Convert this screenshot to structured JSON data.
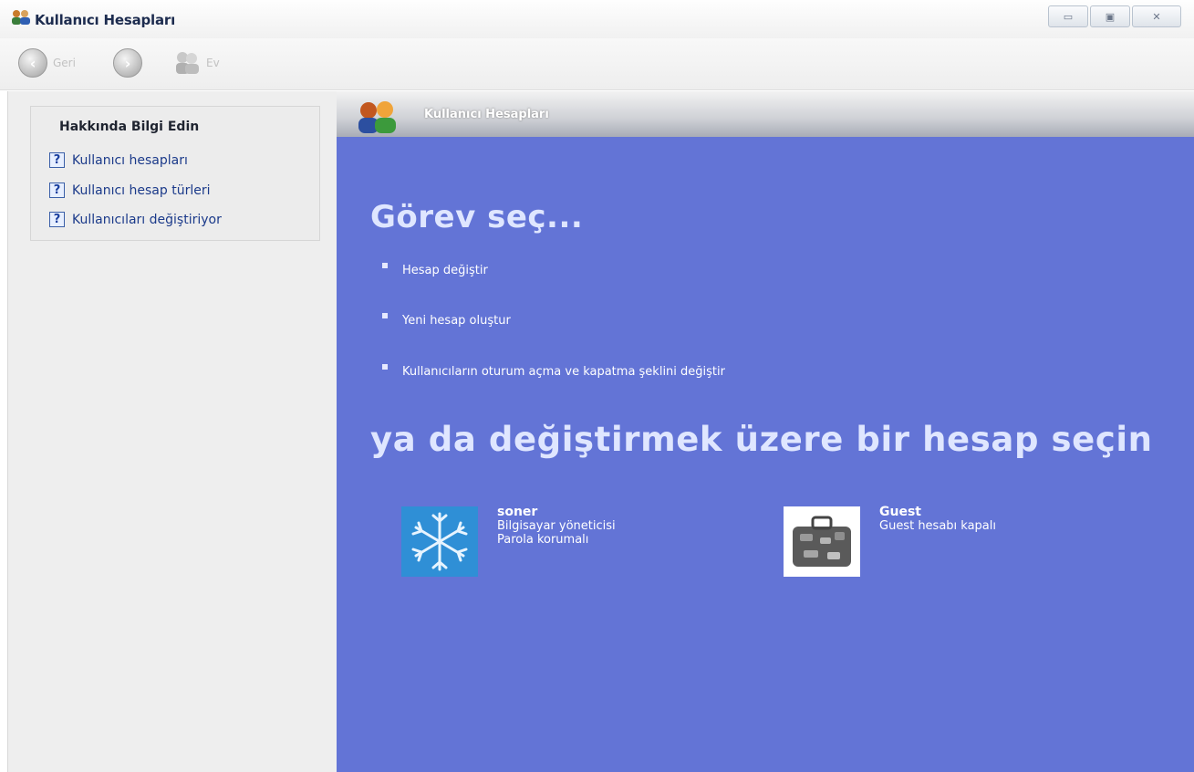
{
  "window": {
    "title": "Kullanıcı Hesapları",
    "controls": [
      "minimize",
      "maximize",
      "close"
    ]
  },
  "toolbar": {
    "back_label": "Geri",
    "home_label": "Ev"
  },
  "sidebar": {
    "title": "Hakkında Bilgi Edin",
    "links": [
      {
        "label": "Kullanıcı hesapları",
        "icon": "help-icon"
      },
      {
        "label": "Kullanıcı hesap türleri",
        "icon": "help-icon"
      },
      {
        "label": "Kullanıcıları değiştiriyor",
        "icon": "help-icon"
      }
    ]
  },
  "main": {
    "header_title": "Kullanıcı Hesapları",
    "task_title": "Görev seç...",
    "tasks": [
      {
        "label": "Hesap değiştir"
      },
      {
        "label": "Yeni hesap oluştur"
      },
      {
        "label": "Kullanıcıların oturum açma ve kapatma şeklini değiştir"
      }
    ],
    "pick_title": "ya da değiştirmek üzere bir hesap seçin",
    "accounts": [
      {
        "name": "soner",
        "lines": [
          "Bilgisayar yöneticisi",
          "Parola korumalı"
        ],
        "avatar": "snowflake-avatar"
      },
      {
        "name": "Guest",
        "lines": [
          "Guest hesabı kapalı"
        ],
        "avatar": "suitcase-avatar"
      }
    ]
  },
  "colors": {
    "main_background": "#6374d6",
    "sidebar_background": "#eeeeee",
    "link_color": "#1b3a8a"
  }
}
